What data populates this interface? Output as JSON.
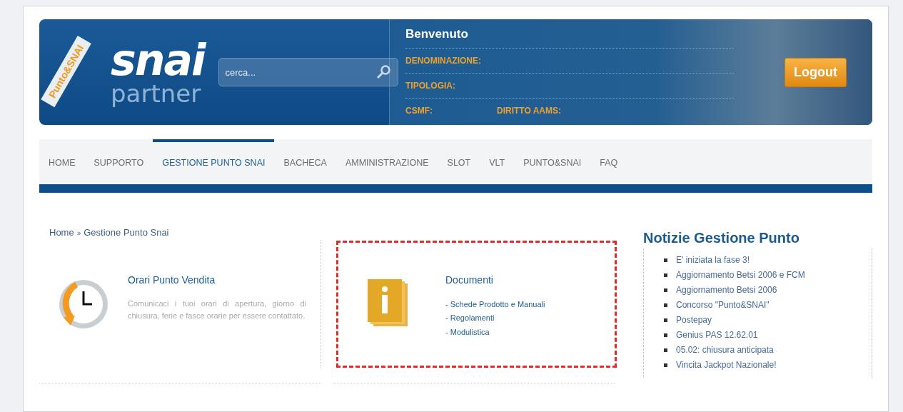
{
  "header": {
    "logo_ribbon": "Punto&SNAI",
    "logo_text": "snai",
    "logo_sub": "partner",
    "search": {
      "placeholder": "cerca..."
    },
    "welcome": "Benvenuto",
    "fields": [
      {
        "label": "DENOMINAZIONE:"
      },
      {
        "label": "TIPOLOGIA:"
      },
      {
        "label": "CSMF:",
        "extra": "DIRITTO AAMS:"
      }
    ],
    "logout": "Logout"
  },
  "nav": [
    {
      "label": "HOME",
      "selected": false
    },
    {
      "label": "SUPPORTO",
      "selected": false
    },
    {
      "label": "GESTIONE PUNTO SNAI",
      "selected": true
    },
    {
      "label": "BACHECA",
      "selected": false
    },
    {
      "label": "AMMINISTRAZIONE",
      "selected": false
    },
    {
      "label": "SLOT",
      "selected": false
    },
    {
      "label": "VLT",
      "selected": false
    },
    {
      "label": "PUNTO&SNAI",
      "selected": false
    },
    {
      "label": "FAQ",
      "selected": false
    }
  ],
  "breadcrumb": [
    "Home",
    "Gestione Punto Snai"
  ],
  "breadcrumb_separator": "»",
  "cards": [
    {
      "kind": "clock",
      "title": "Orari Punto Vendita",
      "highlighted": false,
      "text": "Comunicaci i tuoi orari di apertura, giorno di chiusura, ferie e fasce orarie per essere contattato."
    },
    {
      "kind": "info",
      "title": "Documenti",
      "highlighted": true,
      "links": [
        "- Schede Prodotto e Manuali",
        "- Regolamenti",
        "- Modulistica"
      ]
    }
  ],
  "news": {
    "title": "Notizie Gestione Punto",
    "items": [
      "E' iniziata la fase 3!",
      "Aggiornamento Betsi 2006 e FCM",
      "Aggiornamento Betsi 2006",
      "Concorso \"Punto&SNAI\"",
      "Postepay",
      "Genius PAS 12.62.01",
      "05.02: chiusura anticipata",
      "Vincita Jackpot Nazionale!"
    ]
  }
}
